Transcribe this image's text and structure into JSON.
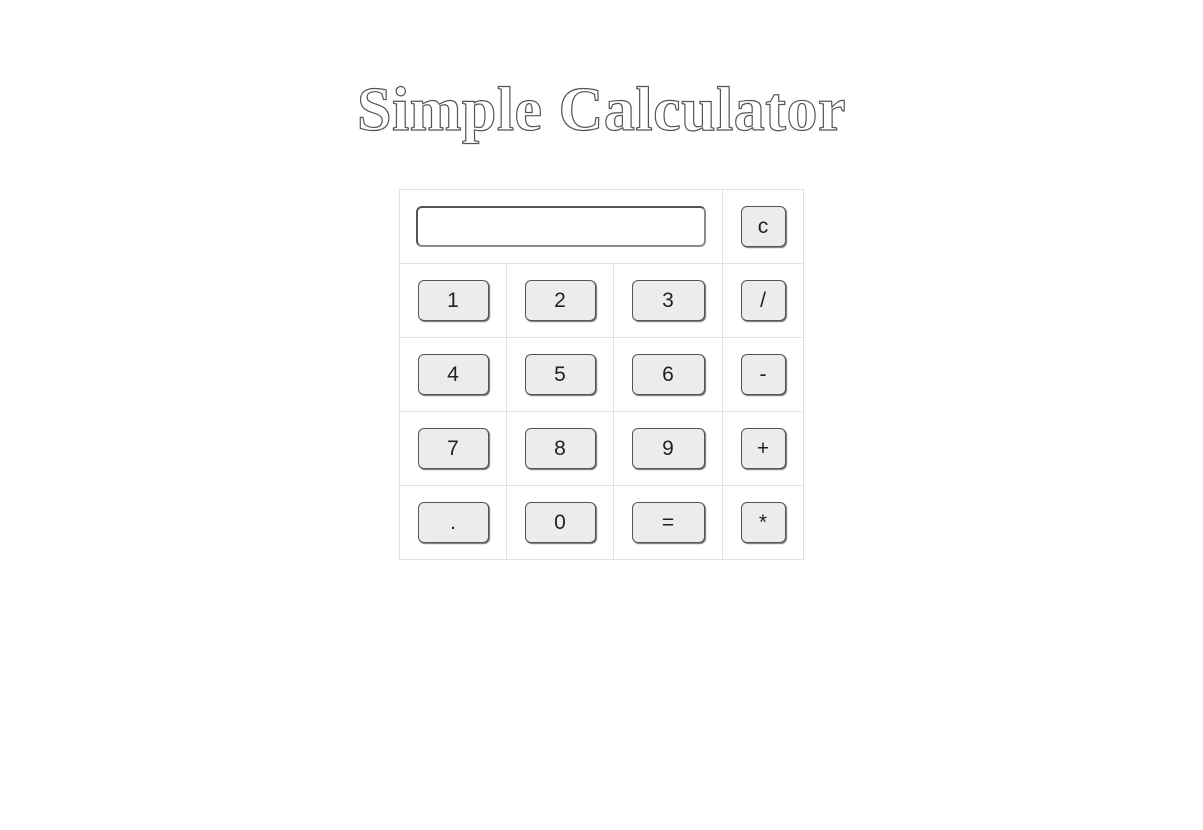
{
  "page": {
    "title": "Simple Calculator"
  },
  "display": {
    "value": ""
  },
  "buttons": {
    "clear": "c",
    "one": "1",
    "two": "2",
    "three": "3",
    "divide": "/",
    "four": "4",
    "five": "5",
    "six": "6",
    "minus": "-",
    "seven": "7",
    "eight": "8",
    "nine": "9",
    "plus": "+",
    "decimal": ".",
    "zero": "0",
    "equals": "=",
    "multiply": "*"
  }
}
